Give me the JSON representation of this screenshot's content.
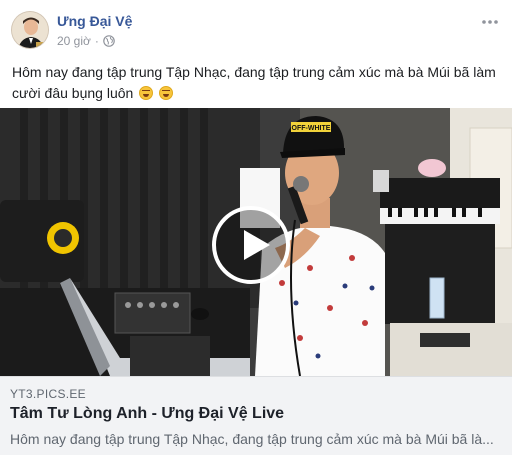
{
  "post": {
    "author": "Ưng Đại Vệ",
    "time": "20 giờ",
    "separator": "·",
    "privacy_icon": "globe-icon",
    "more_icon": "more-options-icon",
    "text": "Hôm nay đang tập trung Tập Nhạc, đang tập trung cảm xúc mà bà Múi bã làm cười đâu bụng luôn",
    "emojis": [
      "rolling-laughing-emoji",
      "rolling-laughing-emoji"
    ]
  },
  "video": {
    "cap_text": "OFF-WHITE",
    "play_icon": "play-icon"
  },
  "link_preview": {
    "domain": "YT3.PICS.EE",
    "title": "Tâm Tư Lòng Anh - Ưng Đại Vệ Live",
    "description": "Hôm nay đang tập trung Tập Nhạc, đang tập trung cảm xúc mà bà Múi bã là..."
  },
  "colors": {
    "author": "#385898",
    "meta": "#90949c",
    "link_bg": "#f2f3f5",
    "link_desc": "#606770"
  }
}
